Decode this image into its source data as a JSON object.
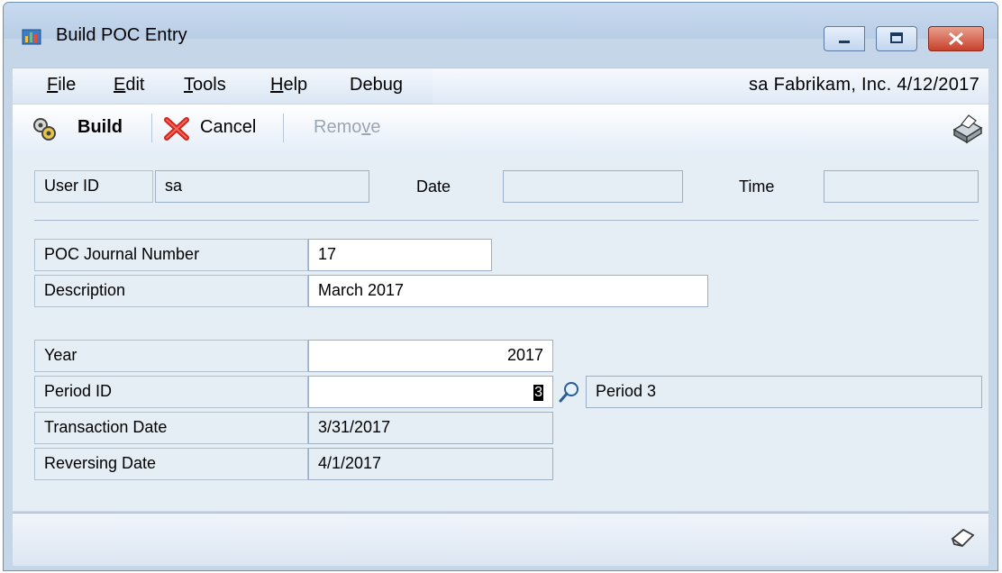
{
  "window": {
    "title": "Build POC Entry"
  },
  "menu": {
    "items": [
      {
        "label": "File",
        "accel": "F",
        "rest": "ile"
      },
      {
        "label": "Edit",
        "accel": "E",
        "rest": "dit"
      },
      {
        "label": "Tools",
        "accel": "T",
        "rest": "ools"
      },
      {
        "label": "Help",
        "accel": "H",
        "rest": "elp"
      },
      {
        "label": "Debug",
        "pre": "Debu",
        "accel": "g"
      }
    ],
    "session": "sa  Fabrikam, Inc.  4/12/2017"
  },
  "toolbar": {
    "build_label": "Build",
    "cancel_label": "Cancel",
    "remove_pre": "Remo",
    "remove_accel": "v",
    "remove_post": "e"
  },
  "header": {
    "user_id_label": "User ID",
    "user_id_value": "sa",
    "date_label": "Date",
    "date_value": "",
    "time_label": "Time",
    "time_value": ""
  },
  "form": {
    "journal_label": "POC Journal Number",
    "journal_value": "17",
    "description_label": "Description",
    "description_value": "March 2017",
    "year_label": "Year",
    "year_value": "2017",
    "period_label": "Period ID",
    "period_value": "3",
    "period_name": "Period 3",
    "trx_date_label": "Transaction Date",
    "trx_date_value": "3/31/2017",
    "rev_date_label": "Reversing Date",
    "rev_date_value": "4/1/2017"
  },
  "colors": {
    "accent": "#c5d6e9",
    "close": "#c8412c"
  },
  "icons": [
    "build-gears-icon",
    "cancel-x-icon",
    "printer-icon",
    "lookup-magnifier-icon",
    "note-icon",
    "app-icon",
    "minimize-icon",
    "maximize-icon",
    "close-icon"
  ]
}
